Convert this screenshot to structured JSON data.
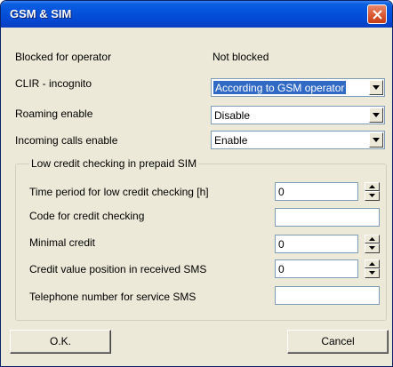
{
  "window": {
    "title": "GSM & SIM"
  },
  "fields": {
    "blocked_label": "Blocked for operator",
    "blocked_value": "Not blocked",
    "clir_label": "CLIR - incognito",
    "clir_value": "According to GSM operator",
    "roaming_label": "Roaming enable",
    "roaming_value": "Disable",
    "incoming_label": "Incoming calls enable",
    "incoming_value": "Enable"
  },
  "group": {
    "title": "Low credit checking in prepaid SIM",
    "time_period_label": "Time period for low credit checking [h]",
    "time_period_value": "0",
    "code_label": "Code for credit checking",
    "code_value": "",
    "minimal_label": "Minimal credit",
    "minimal_value": "0",
    "position_label": "Credit value position in received SMS",
    "position_value": "0",
    "phone_label": "Telephone number for service SMS",
    "phone_value": ""
  },
  "buttons": {
    "ok": "O.K.",
    "cancel": "Cancel"
  },
  "colors": {
    "titlebar": "#0553dc",
    "selection": "#316ac5",
    "dialog_bg": "#ece9d8"
  },
  "icons": {
    "close": "close-icon",
    "dropdown": "chevron-down-icon",
    "spin_up": "arrow-up-icon",
    "spin_down": "arrow-down-icon"
  }
}
